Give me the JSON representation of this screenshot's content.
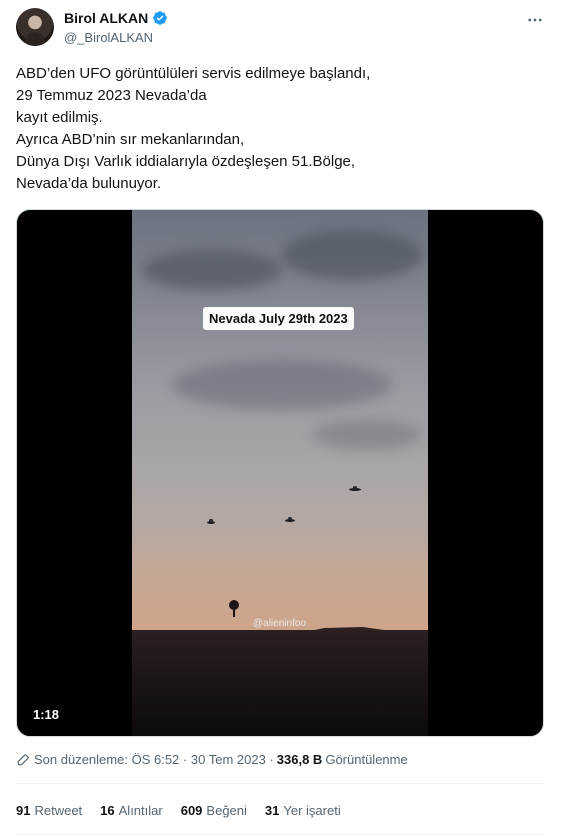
{
  "author": {
    "display_name": "Birol ALKAN",
    "handle": "@_BirolALKAN",
    "verified": true
  },
  "more_icon": "more-horizontal-icon",
  "tweet": {
    "text": "ABD’den UFO görüntülüleri servis edilmeye başlandı,\n 29 Temmuz 2023 Nevada’da\nkayıt edilmiş.\nAyrıca ABD’nin sır mekanlarından,\nDünya Dışı Varlık iddialarıyla özdeşleşen 51.Bölge,\nNevada’da bulunuyor."
  },
  "video": {
    "caption": "Nevada July 29th 2023",
    "watermark": "@alieninfoo",
    "duration": "1:18"
  },
  "meta": {
    "edited_label": "Son düzenleme:",
    "time": "ÖS 6:52",
    "separator": "·",
    "date": "30 Tem 2023",
    "views_count": "336,8 B",
    "views_label": "Görüntülenme"
  },
  "stats": [
    {
      "count": "91",
      "label": "Retweet"
    },
    {
      "count": "16",
      "label": "Alıntılar"
    },
    {
      "count": "609",
      "label": "Beğeni"
    },
    {
      "count": "31",
      "label": "Yer işareti"
    }
  ],
  "colors": {
    "verified": "#1d9bf0",
    "secondary_text": "#536471",
    "primary_text": "#0f1419"
  }
}
